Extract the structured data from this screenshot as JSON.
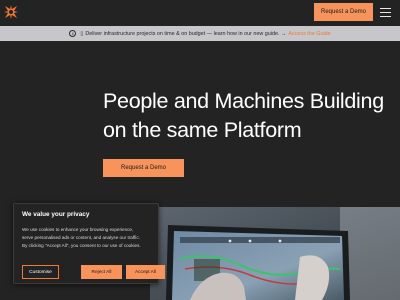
{
  "header": {
    "logo_icon": "asterisk-logo-icon",
    "request_demo_label": "Request a Demo",
    "menu_icon": "hamburger-menu-icon"
  },
  "banner": {
    "info_icon": "info-icon",
    "glyph": "▯",
    "text": "Deliver infrastructure projects on time & on budget — learn how in our new guide. →",
    "link_label": "Access the Guide"
  },
  "hero": {
    "title_line1": "People and Machines Building",
    "title_line2": "on the same Platform",
    "cta_label": "Request a Demo"
  },
  "cookie_banner": {
    "title": "We value your privacy",
    "body_line1": "We use cookies to enhance your browsing experience,",
    "body_line2": "serve personalised ads or content, and analyse our traffic.",
    "body_line3": "By clicking \"Accept All\", you consent to our use of cookies.",
    "customise_label": "Customise",
    "reject_label": "Reject All",
    "accept_label": "Accept All"
  },
  "colors": {
    "background": "#232323",
    "accent": "#f7935b",
    "link": "#ef7a36",
    "banner_bg": "#c6c6cb"
  }
}
